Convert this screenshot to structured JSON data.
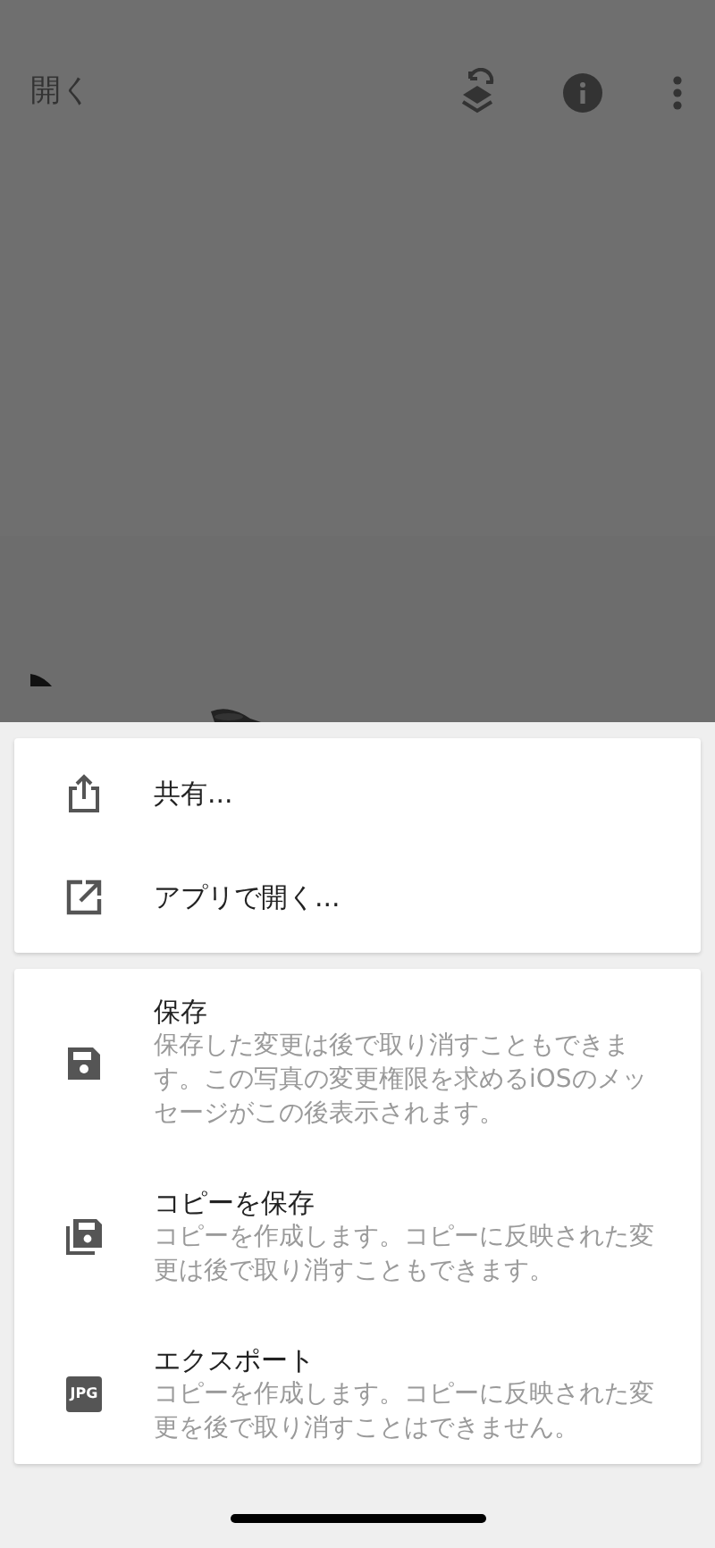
{
  "top_bar": {
    "open_label": "開く"
  },
  "share_card": {
    "items": [
      {
        "label": "共有..."
      },
      {
        "label": "アプリで開く..."
      }
    ]
  },
  "save_card": {
    "items": [
      {
        "title": "保存",
        "description": "保存した変更は後で取り消すこともできます。この写真の変更権限を求めるiOSのメッセージがこの後表示されます。"
      },
      {
        "title": "コピーを保存",
        "description": "コピーを作成します。コピーに反映された変更は後で取り消すこともできます。"
      },
      {
        "title": "エクスポート",
        "description": "コピーを作成します。コピーに反映された変更を後で取り消すことはできません。",
        "icon_label": "JPG"
      }
    ]
  }
}
